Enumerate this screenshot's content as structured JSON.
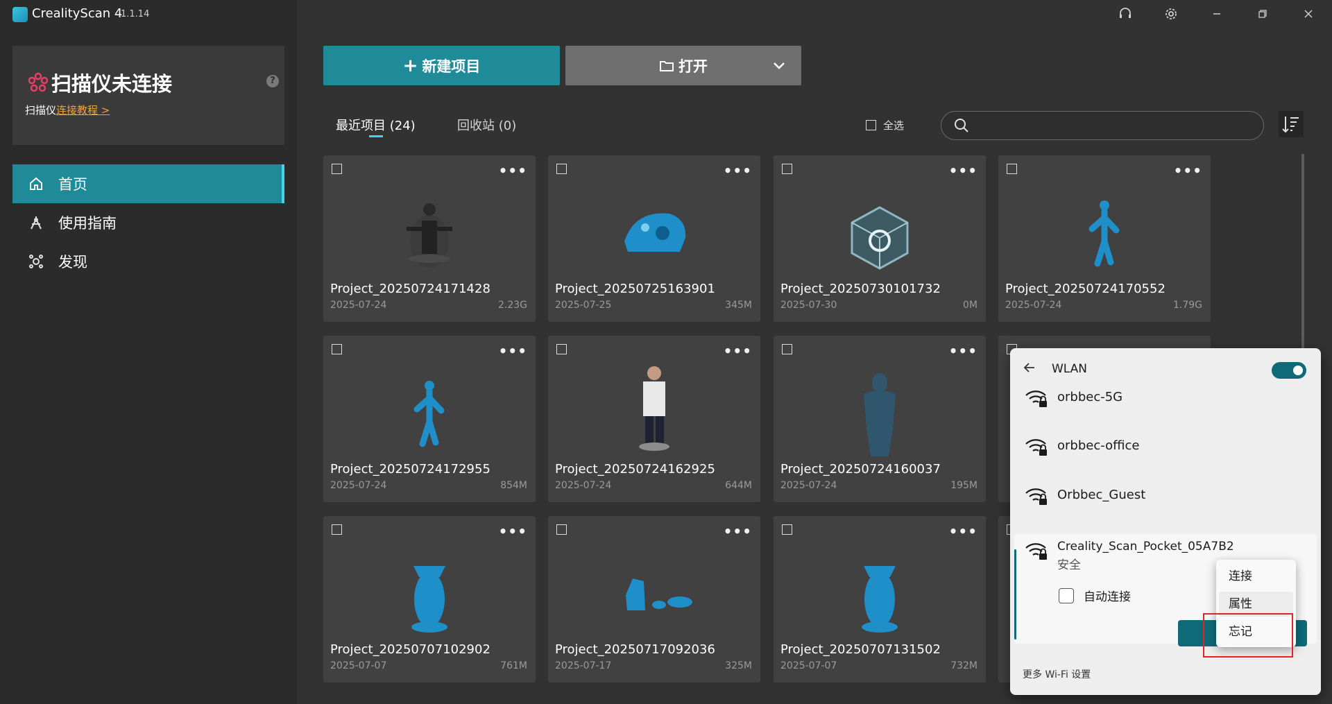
{
  "app": {
    "title": "CrealityScan 4",
    "version": "1.1.14"
  },
  "titlebar_icons": [
    "headset-icon",
    "gear-icon",
    "minimize-icon",
    "restore-icon",
    "close-icon"
  ],
  "scanner": {
    "status": "扫描仪未连接",
    "tutorial_prefix": "扫描仪",
    "tutorial_link": "连接教程 >",
    "help": "?"
  },
  "nav": {
    "home": "首页",
    "guide": "使用指南",
    "discover": "发现"
  },
  "toolbar": {
    "new_project": "新建项目",
    "open": "打开"
  },
  "tabs": {
    "recent": "最近项目 (24)",
    "trash": "回收站 (0)"
  },
  "select_all": "全选",
  "search": {
    "placeholder": ""
  },
  "projects": [
    {
      "name": "Project_20250724171428",
      "date": "2025-07-24",
      "size": "2.23G"
    },
    {
      "name": "Project_20250725163901",
      "date": "2025-07-25",
      "size": "345M"
    },
    {
      "name": "Project_20250730101732",
      "date": "2025-07-30",
      "size": "0M"
    },
    {
      "name": "Project_20250724170552",
      "date": "2025-07-24",
      "size": "1.79G"
    },
    {
      "name": "Project_20250724172955",
      "date": "2025-07-24",
      "size": "854M"
    },
    {
      "name": "Project_20250724162925",
      "date": "2025-07-24",
      "size": "644M"
    },
    {
      "name": "Project_20250724160037",
      "date": "2025-07-24",
      "size": "195M"
    },
    {
      "name": "Project_20250707102902",
      "date": "2025-07-07",
      "size": "761M"
    },
    {
      "name": "Project_20250717092036",
      "date": "2025-07-17",
      "size": "325M"
    },
    {
      "name": "Project_20250707131502",
      "date": "2025-07-07",
      "size": "732M"
    }
  ],
  "card_more": "•••",
  "wlan": {
    "title": "WLAN",
    "enabled": true,
    "networks": [
      "orbbec-5G",
      "orbbec-office",
      "Orbbec_Guest"
    ],
    "active_network": "Creality_Scan_Pocket_05A7B2",
    "active_security": "安全",
    "auto_connect": "自动连接",
    "more_settings": "更多 Wi-Fi 设置"
  },
  "context_menu": {
    "connect": "连接",
    "properties": "属性",
    "forget": "忘记"
  },
  "colors": {
    "accent": "#1f8a98",
    "accent_bright": "#3fd5ea",
    "link": "#f3a42f",
    "highlight": "#e02424",
    "model_blue": "#1e8fc8"
  }
}
